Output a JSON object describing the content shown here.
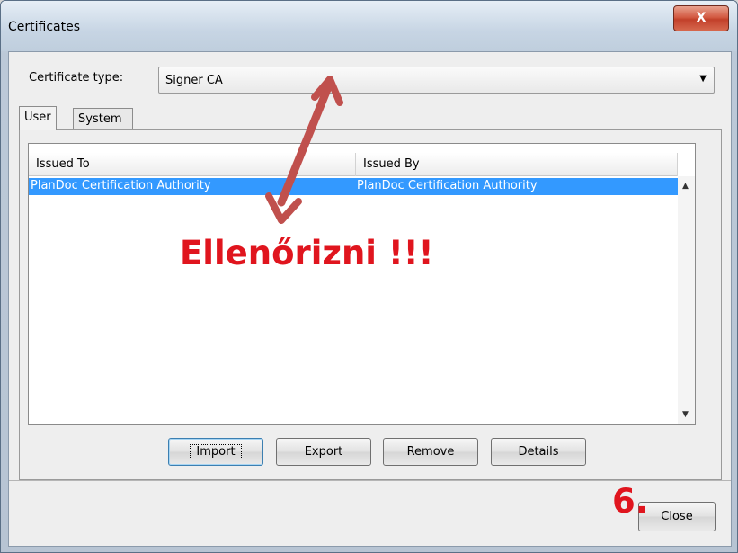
{
  "window": {
    "title": "Certificates",
    "close_glyph": "X"
  },
  "certificate_type": {
    "label": "Certificate type:",
    "value": "Signer CA"
  },
  "tabs": [
    {
      "label": "User",
      "active": true
    },
    {
      "label": "System",
      "active": false
    }
  ],
  "table": {
    "columns": [
      "Issued To",
      "Issued By"
    ],
    "rows": [
      {
        "issued_to": "PlanDoc Certification Authority",
        "issued_by": "PlanDoc Certification Authority",
        "selected": true
      }
    ]
  },
  "buttons": {
    "import": "Import",
    "export": "Export",
    "remove": "Remove",
    "details": "Details",
    "close": "Close"
  },
  "annotations": {
    "check_note": "Ellenőrizni !!!",
    "step_number": "6.",
    "color": "#e0151e"
  },
  "colors": {
    "selection": "#3399ff",
    "title_close": "#c2402a"
  }
}
